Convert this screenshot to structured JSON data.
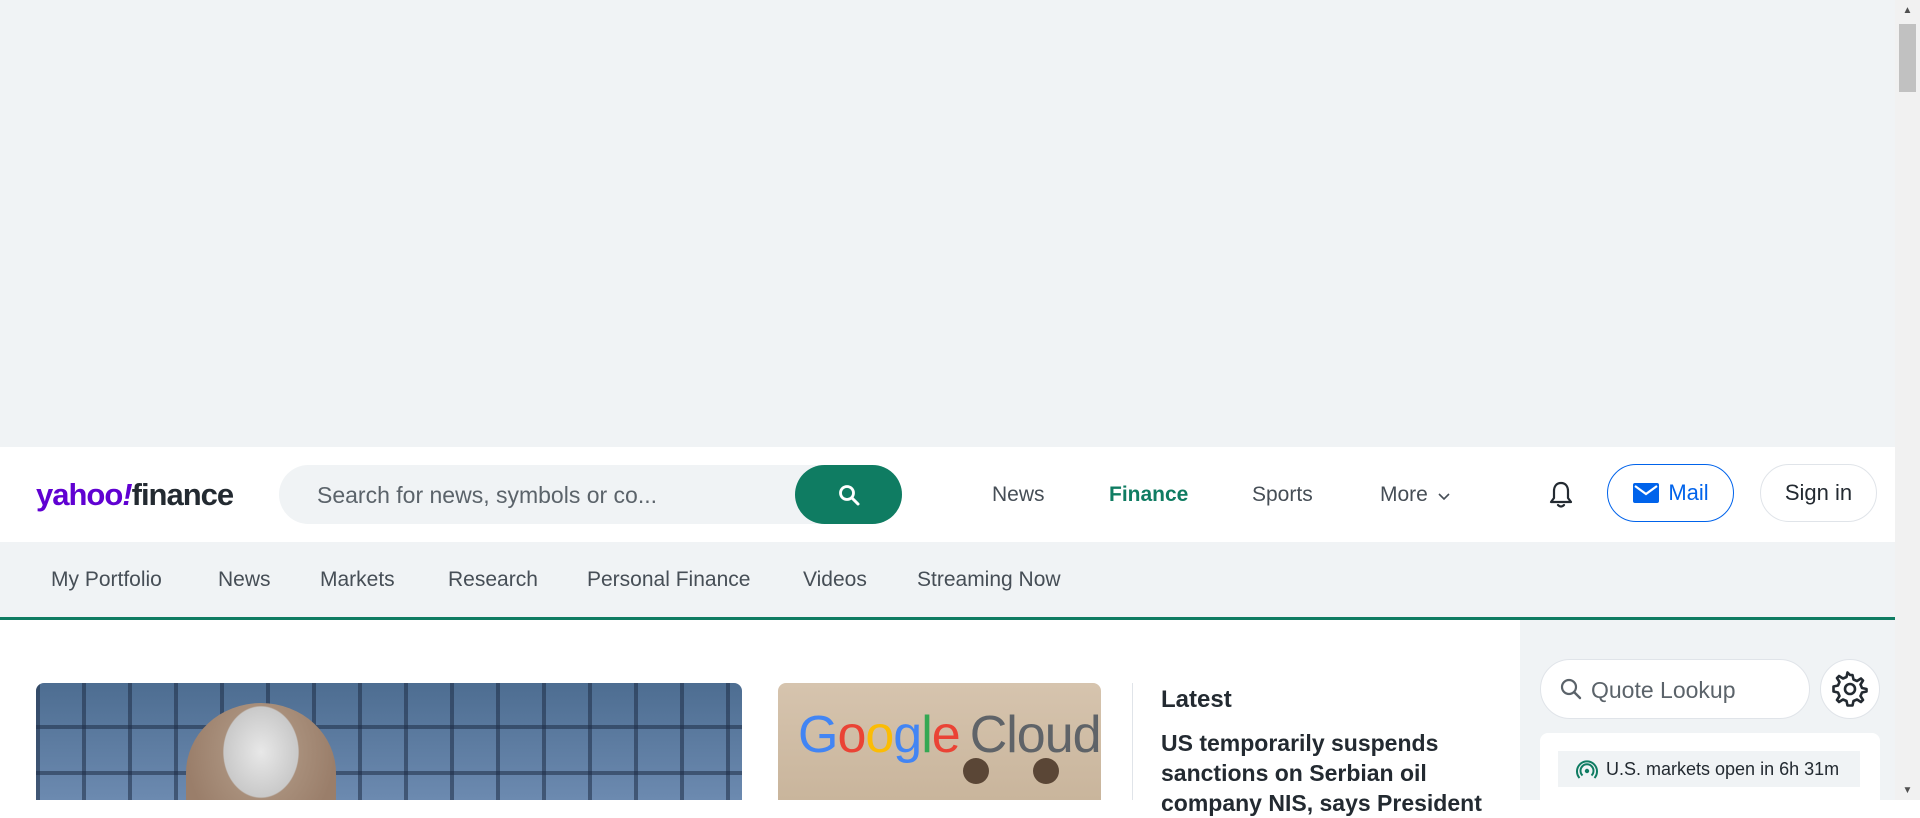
{
  "header": {
    "logo": {
      "yahoo": "yahoo",
      "bang": "!",
      "finance": "finance"
    },
    "search_placeholder": "Search for news, symbols or co...",
    "nav": [
      {
        "label": "News",
        "active": false
      },
      {
        "label": "Finance",
        "active": true
      },
      {
        "label": "Sports",
        "active": false
      },
      {
        "label": "More",
        "active": false
      }
    ],
    "mail_label": "Mail",
    "signin_label": "Sign in"
  },
  "subnav": {
    "items": [
      "My Portfolio",
      "News",
      "Markets",
      "Research",
      "Personal Finance",
      "Videos",
      "Streaming Now"
    ]
  },
  "main": {
    "second_image_logo": {
      "google": "Google",
      "cloud": "Cloud"
    },
    "latest": {
      "title": "Latest",
      "headline": "US temporarily suspends sanctions on Serbian oil company NIS, says President"
    }
  },
  "rail": {
    "quote_lookup_placeholder": "Quote Lookup",
    "market_status": "U.S. markets open in 6h 31m"
  },
  "colors": {
    "brand_purple": "#6001d2",
    "accent_green": "#0f7c62",
    "mail_blue": "#0063eb",
    "background_gray": "#f0f3f5"
  },
  "icons": [
    "search-icon",
    "chevron-down-icon",
    "bell-icon",
    "mail-icon",
    "search-icon",
    "gear-icon",
    "market-signal-icon"
  ]
}
